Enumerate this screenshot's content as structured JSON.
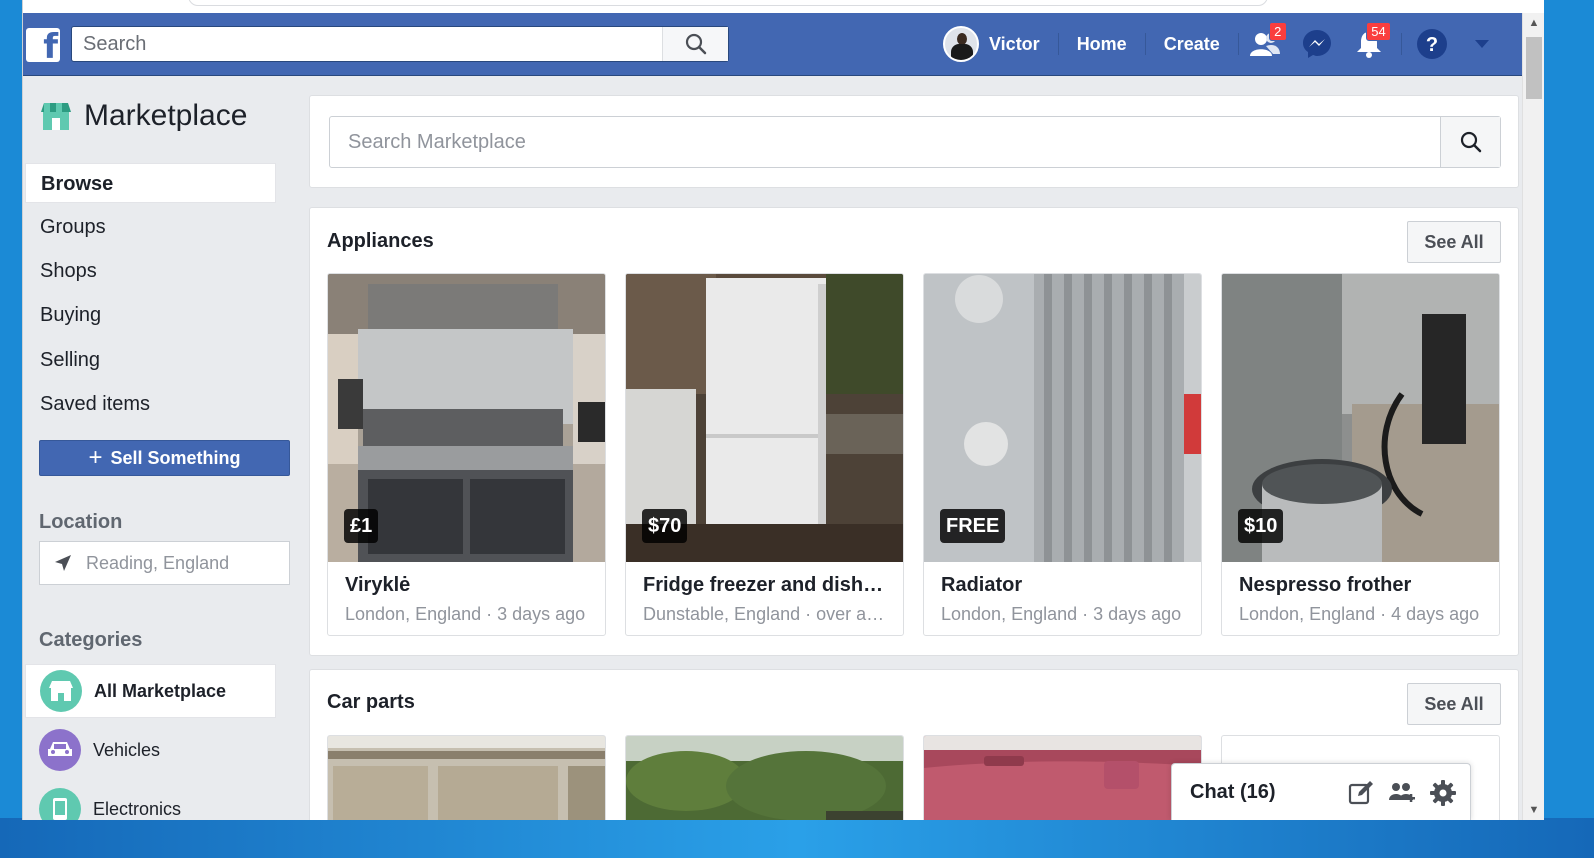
{
  "header": {
    "search_placeholder": "Search",
    "user_name": "Victor",
    "home": "Home",
    "create": "Create",
    "friend_requests_count": "2",
    "notifications_count": "54"
  },
  "sidebar": {
    "title": "Marketplace",
    "nav": [
      "Browse",
      "Groups",
      "Shops",
      "Buying",
      "Selling",
      "Saved items"
    ],
    "sell_button": "Sell Something",
    "location_title": "Location",
    "location_value": "Reading, England",
    "categories_title": "Categories",
    "categories": [
      {
        "label": "All Marketplace",
        "color": "#5fc9b0",
        "icon": "store-icon"
      },
      {
        "label": "Vehicles",
        "color": "#8c72cb",
        "icon": "car-icon"
      },
      {
        "label": "Electronics",
        "color": "#5fc9b0",
        "icon": "phone-icon"
      }
    ]
  },
  "main": {
    "search_placeholder": "Search Marketplace",
    "sections": [
      {
        "title": "Appliances",
        "see_all": "See All",
        "items": [
          {
            "price": "£1",
            "title": "Viryklė",
            "meta": "London, England · 3 days ago"
          },
          {
            "price": "$70",
            "title": "Fridge freezer and dishwasher",
            "meta": "Dunstable, England · over a week ago"
          },
          {
            "price": "FREE",
            "title": "Radiator",
            "meta": "London, England · 3 days ago"
          },
          {
            "price": "$10",
            "title": "Nespresso frother",
            "meta": "London, England · 4 days ago"
          }
        ]
      },
      {
        "title": "Car parts",
        "see_all": "See All"
      }
    ]
  },
  "chat": {
    "label": "Chat (16)"
  },
  "colors": {
    "brand": "#4267b2",
    "badge": "#fa3e3e",
    "accent_teal": "#5fc9b0",
    "accent_purple": "#8c72cb"
  }
}
